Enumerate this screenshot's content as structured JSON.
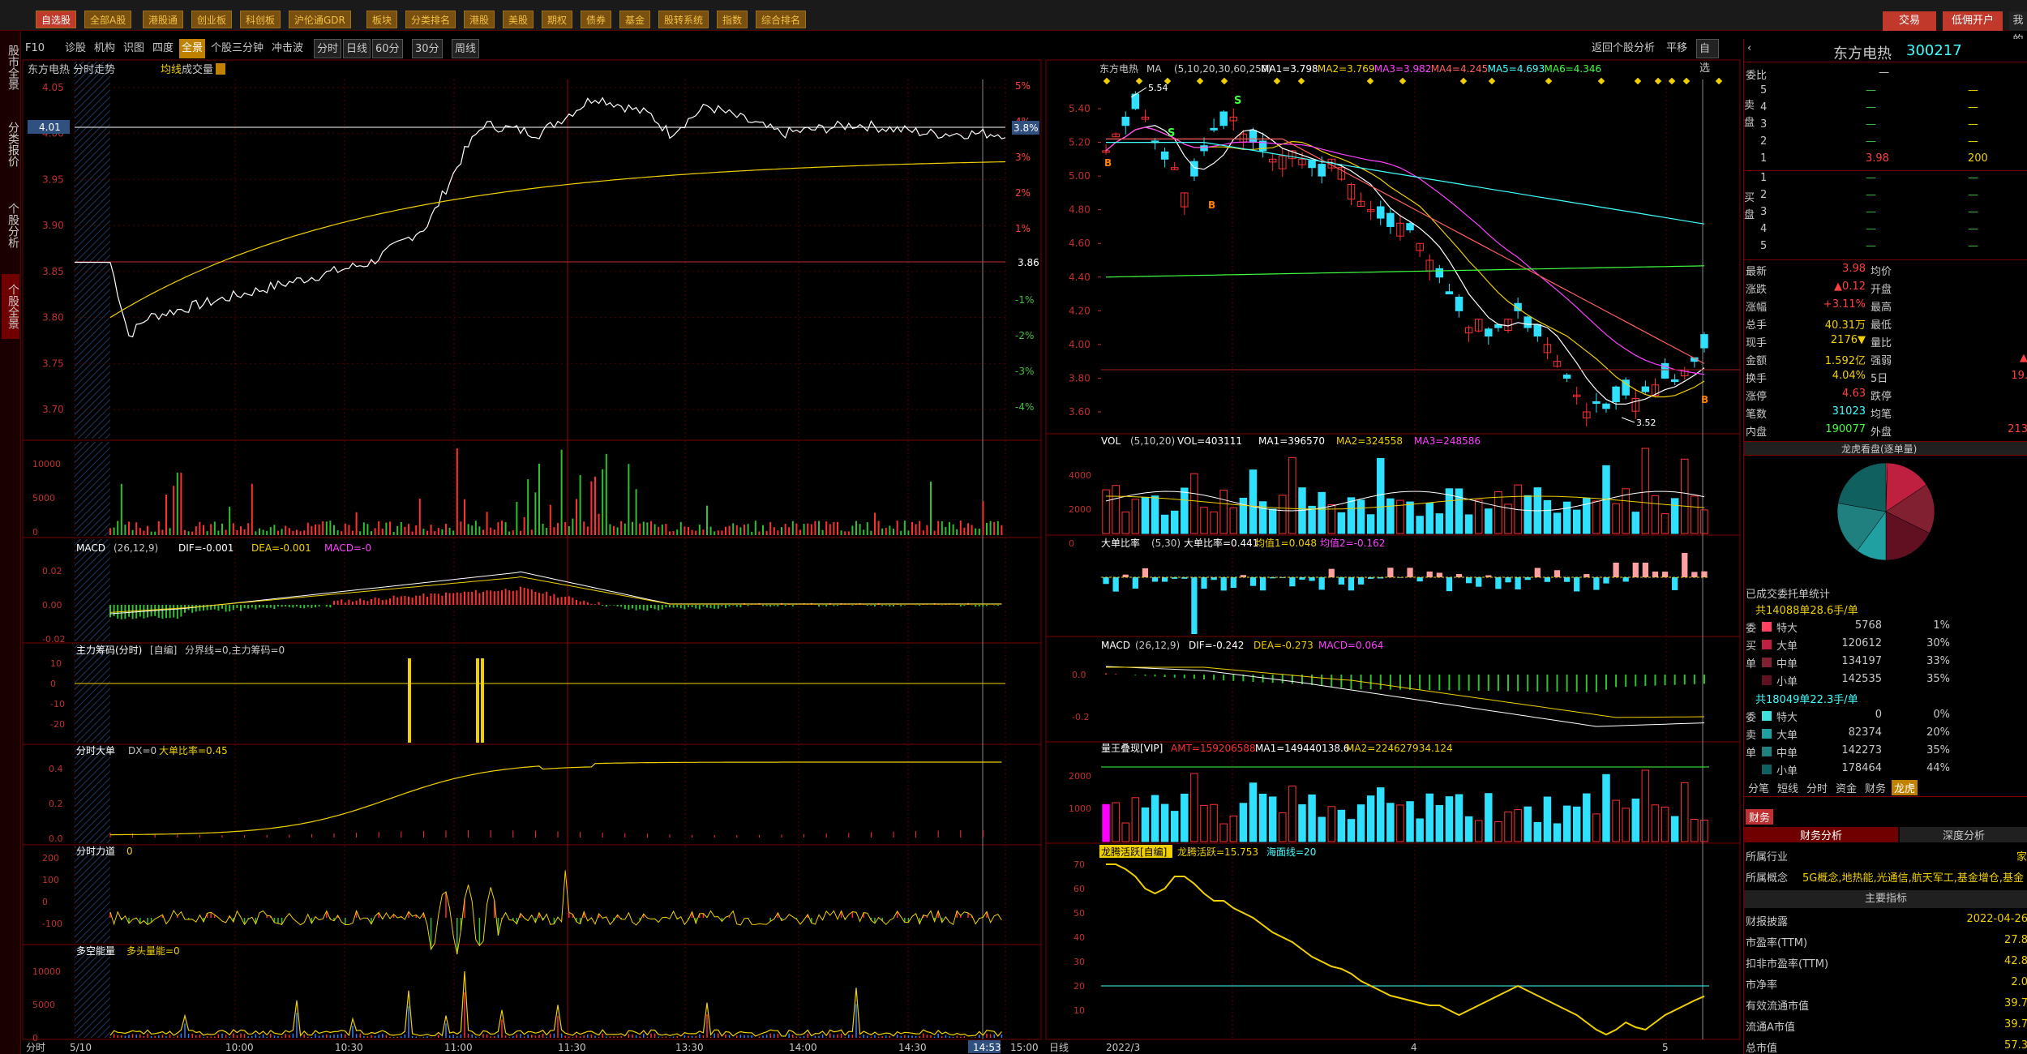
{
  "topnav": {
    "items": [
      "自选股",
      "全部A股",
      "港股通",
      "创业板",
      "科创板",
      "沪伦通GDR",
      "板块",
      "分类排名",
      "港股",
      "美股",
      "期权",
      "债券",
      "基金",
      "股转系统",
      "指数",
      "综合排名"
    ],
    "active": "自选股"
  },
  "topbuttons": {
    "trade": "交易",
    "low_commission": "低佣开户",
    "news": "我的"
  },
  "leftrail": [
    "股市全景",
    "分类报价",
    "个股分析",
    "个股全景"
  ],
  "toolbar": {
    "items": [
      "F10",
      "诊股",
      "机构",
      "识图",
      "四度",
      "全景",
      "个股三分钟",
      "冲击波"
    ],
    "active": "全景",
    "periods": [
      "分时",
      "日线",
      "60分",
      "30分",
      "周线"
    ],
    "right": [
      "返回个股分析",
      "平移",
      "自选"
    ]
  },
  "intraday": {
    "title": "东方电热 分时走势",
    "avg_label": "均线",
    "vol_label": "成交量",
    "price_ticks": [
      "4.05",
      "4.00",
      "3.95",
      "3.90",
      "3.85",
      "3.80",
      "3.75",
      "3.70"
    ],
    "pct_ticks": [
      "5%",
      "4%",
      "3%",
      "2%",
      "1%",
      "",
      "-1%",
      "-2%",
      "-3%",
      "-4%"
    ],
    "highlight_price": "4.01",
    "highlight_pct": "3.8%",
    "base_price": "3.86",
    "times": [
      "5/10",
      "10:00",
      "10:30",
      "11:00",
      "11:30",
      "13:30",
      "14:00",
      "14:30",
      "14:53",
      "15:00"
    ],
    "time_label": "分时",
    "vol_ticks": [
      "10000",
      "5000",
      "0"
    ],
    "macd": {
      "name": "MACD",
      "params": "(26,12,9)",
      "dif": "DIF=-0.001",
      "dea": "DEA=-0.001",
      "macd": "MACD=-0",
      "ticks": [
        "0.02",
        "0.00",
        "-0.02"
      ]
    },
    "zlcm": {
      "name": "主力筹码(分时)",
      "mode": "[自编]",
      "label": "分界线=0,主力筹码=0",
      "ticks": [
        "10",
        "0",
        "-10",
        "-20"
      ]
    },
    "dadan": {
      "name": "分时大单",
      "label": "DX=0",
      "ratio": "大单比率=0.45",
      "ticks": [
        "0.4",
        "0.2",
        "0.0"
      ]
    },
    "lidao": {
      "name": "分时力道",
      "label": "0",
      "ticks": [
        "200",
        "100",
        "0",
        "-100"
      ]
    },
    "dkn": {
      "name": "多空能量",
      "label": "多头量能=0",
      "ticks": [
        "10000",
        "5000",
        "0"
      ]
    }
  },
  "daily": {
    "title": "东方电热",
    "ma_name": "MA",
    "ma_params": "(5,10,20,30,60,250)",
    "ma_values": [
      "MA1=3.798",
      "MA2=3.769",
      "MA3=3.982",
      "MA4=4.245",
      "MA5=4.693",
      "MA6=4.346"
    ],
    "ma_colors": [
      "#ffffff",
      "#f0d000",
      "#ff40ff",
      "#ff6060",
      "#40ffff",
      "#40ff40"
    ],
    "price_ticks": [
      "5.40",
      "5.20",
      "5.00",
      "4.80",
      "4.60",
      "4.40",
      "4.20",
      "4.00",
      "3.80",
      "3.60"
    ],
    "high_label": "5.54",
    "low_label": "3.52",
    "dates": [
      "2022/3",
      "4",
      "5"
    ],
    "date_label": "日线",
    "vol": {
      "name": "VOL",
      "params": "(5,10,20)",
      "values": "VOL=403111",
      "ma1": "MA1=396570",
      "ma2": "MA2=324558",
      "ma3": "MA3=248586",
      "ticks": [
        "4000",
        "2000",
        "0"
      ]
    },
    "ddbl": {
      "name": "大单比率",
      "params": "(5,30)",
      "ratio": "大单比率=0.441",
      "avg1": "均值1=0.048",
      "avg2": "均值2=-0.162"
    },
    "macd": {
      "name": "MACD",
      "params": "(26,12,9)",
      "dif": "DIF=-0.242",
      "dea": "DEA=-0.273",
      "macd": "MACD=0.064",
      "ticks": [
        "0.0",
        "-0.2"
      ]
    },
    "lwdx": {
      "name": "量王叠现[VIP]",
      "amt": "AMT=159206588",
      "ma1": "MA1=149440138.6",
      "ma2": "MA2=224627934.124",
      "ticks": [
        "2000",
        "1000"
      ]
    },
    "lthy": {
      "name": "龙腾活跃[自编]",
      "val": "龙腾活跃=15.753",
      "sea": "海面线=20",
      "ticks": [
        "70",
        "60",
        "50",
        "40",
        "30",
        "20",
        "10"
      ]
    }
  },
  "quote": {
    "name": "东方电热",
    "code": "300217",
    "weibi_label": "委比",
    "weibi_val": "—",
    "sell": [
      {
        "lv": "5",
        "p": "—",
        "v": "—"
      },
      {
        "lv": "4",
        "p": "—",
        "v": "—"
      },
      {
        "lv": "3",
        "p": "—",
        "v": "—"
      },
      {
        "lv": "2",
        "p": "—",
        "v": "—"
      },
      {
        "lv": "1",
        "p": "3.98",
        "v": "200"
      }
    ],
    "buy": [
      {
        "lv": "1",
        "p": "—",
        "v": "—"
      },
      {
        "lv": "2",
        "p": "—",
        "v": "—"
      },
      {
        "lv": "3",
        "p": "—",
        "v": "—"
      },
      {
        "lv": "4",
        "p": "—",
        "v": "—"
      },
      {
        "lv": "5",
        "p": "—",
        "v": "—"
      }
    ],
    "sell_side": "卖盘",
    "buy_side": "买盘",
    "stats": [
      {
        "k": "最新",
        "v": "3.98",
        "k2": "均价",
        "v2": "",
        "c": "#ff4040"
      },
      {
        "k": "涨跌",
        "v": "▲0.12",
        "k2": "开盘",
        "v2": "",
        "c": "#ff4040"
      },
      {
        "k": "涨幅",
        "v": "+3.11%",
        "k2": "最高",
        "v2": "",
        "c": "#ff4040"
      },
      {
        "k": "总手",
        "v": "40.31万",
        "k2": "最低",
        "v2": "",
        "c": "#f0d000"
      },
      {
        "k": "现手",
        "v": "2176▼",
        "k2": "量比",
        "v2": "",
        "c": "#f0d000"
      },
      {
        "k": "金额",
        "v": "1.592亿",
        "k2": "强弱",
        "v2": "▲",
        "c": "#f0d000"
      },
      {
        "k": "换手",
        "v": "4.04%",
        "k2": "5日",
        "v2": "19.",
        "c": "#f0d000"
      },
      {
        "k": "涨停",
        "v": "4.63",
        "k2": "跌停",
        "v2": "",
        "c": "#ff4040"
      },
      {
        "k": "笔数",
        "v": "31023",
        "k2": "均笔",
        "v2": "",
        "c": "#40ffff"
      },
      {
        "k": "内盘",
        "v": "190077",
        "k2": "外盘",
        "v2": "213",
        "c": "#40ff40"
      }
    ],
    "lhk_title": "龙虎看盘(逐单量)",
    "entrust_title": "已成交委托单统计",
    "buy_summary": "共14088单28.6手/单",
    "sell_summary": "共18049单22.3手/单",
    "buy_rows": [
      {
        "t": "特大",
        "n": "5768",
        "p": "1%",
        "c": "#ff4060"
      },
      {
        "t": "大单",
        "n": "120612",
        "p": "30%",
        "c": "#c02040"
      },
      {
        "t": "中单",
        "n": "134197",
        "p": "33%",
        "c": "#802030"
      },
      {
        "t": "小单",
        "n": "142535",
        "p": "35%",
        "c": "#601020"
      }
    ],
    "sell_rows": [
      {
        "t": "特大",
        "n": "0",
        "p": "0%",
        "c": "#40e0e0"
      },
      {
        "t": "大单",
        "n": "82374",
        "p": "20%",
        "c": "#20a0a0"
      },
      {
        "t": "中单",
        "n": "142273",
        "p": "35%",
        "c": "#208080"
      },
      {
        "t": "小单",
        "n": "178464",
        "p": "44%",
        "c": "#106060"
      }
    ],
    "buy_side_label": [
      "委",
      "买",
      "单"
    ],
    "sell_side_label": [
      "委",
      "卖",
      "单"
    ],
    "tabs": [
      "分笔",
      "短线",
      "分时",
      "资金",
      "财务",
      "龙虎"
    ],
    "active_tab": "龙虎",
    "fin_tab": "财务",
    "fin_subtabs": [
      "财务分析",
      "深度分析"
    ],
    "industry_label": "所属行业",
    "industry_val": "家",
    "concept_label": "所属概念",
    "concept_val": "5G概念,地热能,光通信,航天军工,基金增仓,基金",
    "key_title": "主要指标",
    "fin_rows": [
      {
        "k": "财报披露",
        "v": "2022-04-26"
      },
      {
        "k": "市盈率(TTM)",
        "v": "27.8"
      },
      {
        "k": "扣非市盈率(TTM)",
        "v": "42.8"
      },
      {
        "k": "市净率",
        "v": "2.0"
      },
      {
        "k": "有效流通市值",
        "v": "39.7"
      },
      {
        "k": "流通A市值",
        "v": "39.7"
      },
      {
        "k": "总市值",
        "v": "57.3"
      }
    ]
  }
}
